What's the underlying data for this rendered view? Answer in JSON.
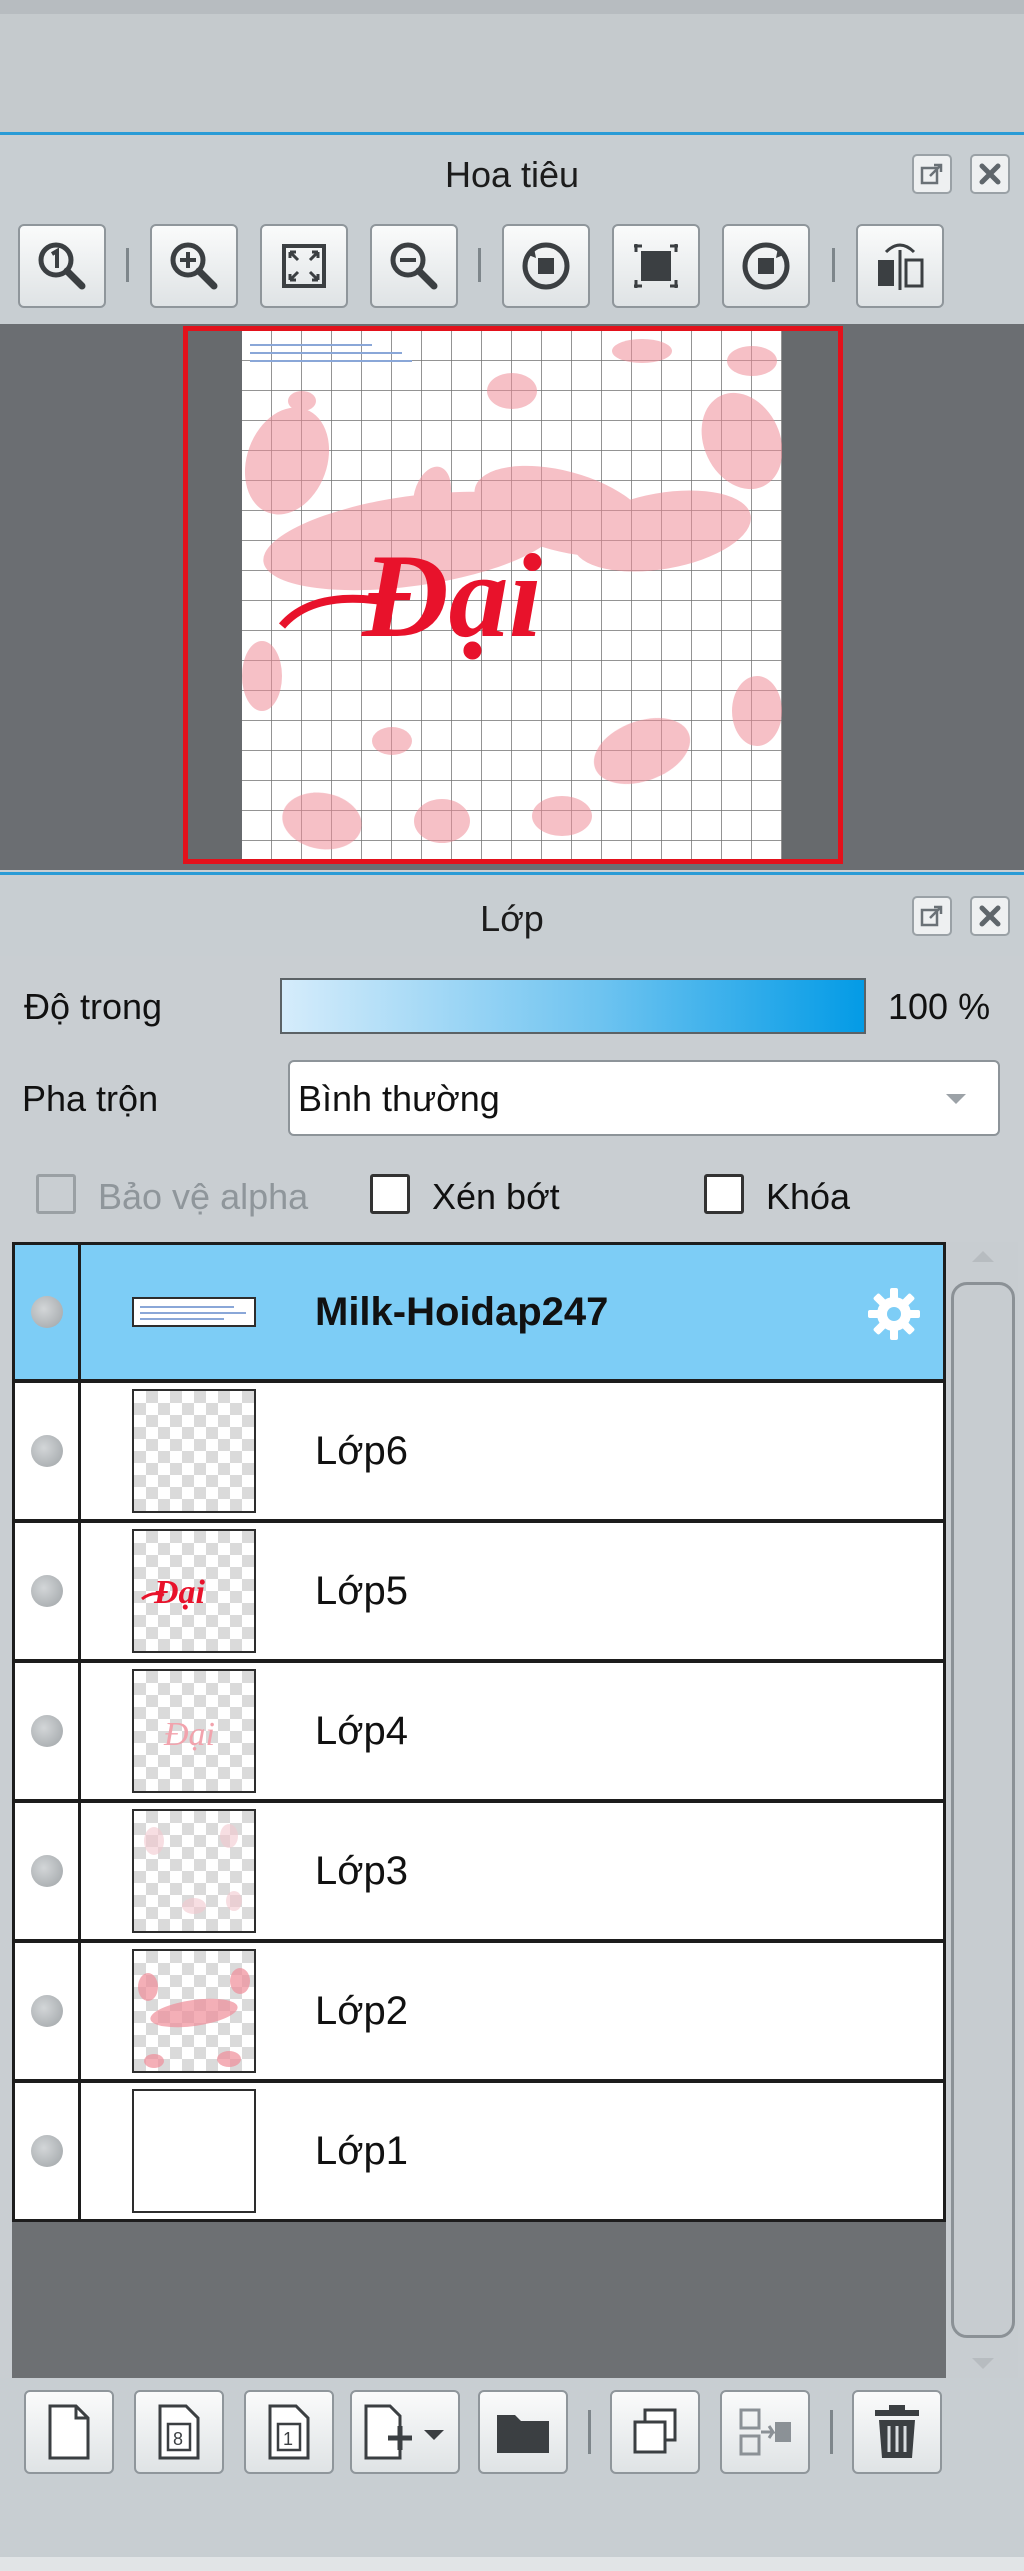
{
  "navigator": {
    "title": "Hoa tiêu",
    "toolbar": [
      {
        "name": "zoom-actual-icon",
        "label": "1"
      },
      {
        "name": "zoom-in-icon"
      },
      {
        "name": "fit-window-icon"
      },
      {
        "name": "zoom-out-icon"
      },
      {
        "name": "rotate-left-icon"
      },
      {
        "name": "reset-view-icon"
      },
      {
        "name": "rotate-right-icon"
      },
      {
        "name": "flip-horizontal-icon"
      }
    ],
    "preview_text": "Đại"
  },
  "layers_panel": {
    "title": "Lớp",
    "opacity_label": "Độ trong",
    "opacity_value": "100 %",
    "opacity_fraction": 1.0,
    "blend_label": "Pha trộn",
    "blend_value": "Bình thường",
    "checkboxes": {
      "alpha": {
        "label": "Bảo vệ alpha",
        "checked": false,
        "disabled": true
      },
      "clip": {
        "label": "Xén bớt",
        "checked": false
      },
      "lock": {
        "label": "Khóa",
        "checked": false
      }
    },
    "layers": [
      {
        "name": "Milk-Hoidap247",
        "selected": true,
        "bold": true
      },
      {
        "name": "Lớp6"
      },
      {
        "name": "Lớp5"
      },
      {
        "name": "Lớp4"
      },
      {
        "name": "Lớp3"
      },
      {
        "name": "Lớp2"
      },
      {
        "name": "Lớp1"
      }
    ],
    "thumb_text": "Đại",
    "bottom_toolbar": [
      "new-layer-icon",
      "new-8bit-layer-icon",
      "new-1bit-layer-icon",
      "add-layer-dropdown-icon",
      "folder-icon",
      "duplicate-layer-icon",
      "merge-down-icon",
      "delete-icon"
    ]
  },
  "colors": {
    "accent": "#2a9bd6",
    "selected_row": "#7dcdf6",
    "frame_red": "#e3111b",
    "preview_red": "#e8122b"
  }
}
